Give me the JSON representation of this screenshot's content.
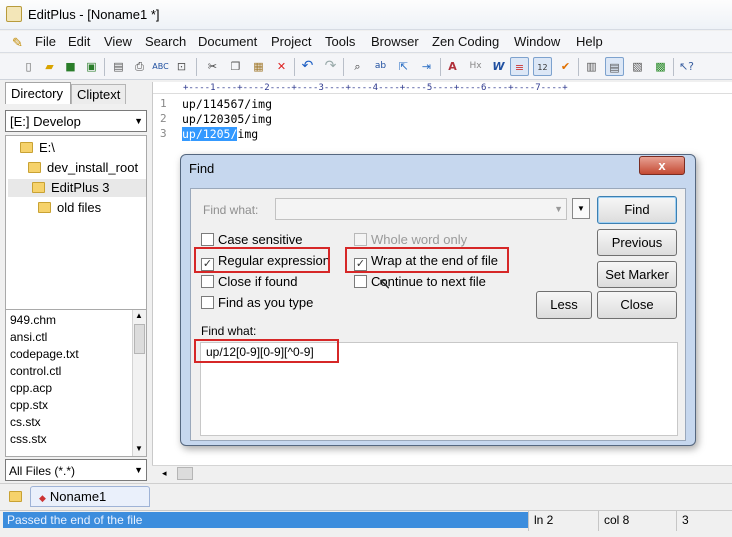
{
  "window": {
    "title": "EditPlus - [Noname1 *]"
  },
  "menu": [
    "File",
    "Edit",
    "View",
    "Search",
    "Document",
    "Project",
    "Tools",
    "Browser",
    "Zen Coding",
    "Window",
    "Help"
  ],
  "toolbar": {
    "icons": [
      "new-file-icon",
      "open-icon",
      "save-icon",
      "save-all-icon",
      "print-preview-icon",
      "print-icon",
      "spell-check-icon",
      "cut-icon",
      "copy-icon",
      "paste-icon",
      "delete-icon",
      "undo-icon",
      "redo-icon",
      "find-icon",
      "replace-icon",
      "goto-icon",
      "find-in-files-icon",
      "font-icon",
      "hex-icon",
      "word-wrap-icon",
      "ruler-icon",
      "line-number-icon",
      "highlight-icon",
      "directory-window-icon",
      "output-window-icon",
      "clip-window-icon",
      "browser-icon",
      "help-icon"
    ]
  },
  "sidebar": {
    "tabs": [
      "Directory",
      "Cliptext"
    ],
    "drive": "[E:] Develop",
    "tree": [
      "E:\\",
      "dev_install_root",
      "EditPlus 3",
      "old files"
    ],
    "files": [
      "949.chm",
      "ansi.ctl",
      "codepage.txt",
      "control.ctl",
      "cpp.acp",
      "cpp.stx",
      "cs.stx",
      "css.stx"
    ],
    "filter": "All Files (*.*)"
  },
  "editor": {
    "ruler": "+----1----+----2----+----3----+----4----+----5----+----6----+----7----+",
    "lines": [
      {
        "num": "1",
        "pre": "",
        "sel": "",
        "text": "up/114567/img"
      },
      {
        "num": "2",
        "pre": "",
        "sel": "",
        "text": "up/120305/img"
      },
      {
        "num": "3",
        "pre": "",
        "sel": "up/1205/",
        "text": "img"
      }
    ]
  },
  "find": {
    "title": "Find",
    "close": "x",
    "find_what_label": "Find what:",
    "find_what_value": "",
    "options": {
      "case_sensitive": "Case sensitive",
      "regex": "Regular expression",
      "close_if_found": "Close if found",
      "find_as_you_type": "Find as you type",
      "whole_word": "Whole word only",
      "wrap": "Wrap at the end of file",
      "continue_next": "Continue to next file"
    },
    "checked": {
      "case_sensitive": false,
      "regex": true,
      "close_if_found": false,
      "find_as_you_type": false,
      "whole_word": false,
      "wrap": true,
      "continue_next": false
    },
    "buttons": {
      "find": "Find",
      "previous": "Previous",
      "set_marker": "Set Marker",
      "less": "Less",
      "close": "Close"
    },
    "find_what2_label": "Find what:",
    "find_what2_value": "up/12[0-9][0-9][^0-9]"
  },
  "doc_tab": {
    "label": "Noname1"
  },
  "status": {
    "message": "Passed the end of the file",
    "line": "ln 2",
    "col": "col 8",
    "extra": "3"
  }
}
